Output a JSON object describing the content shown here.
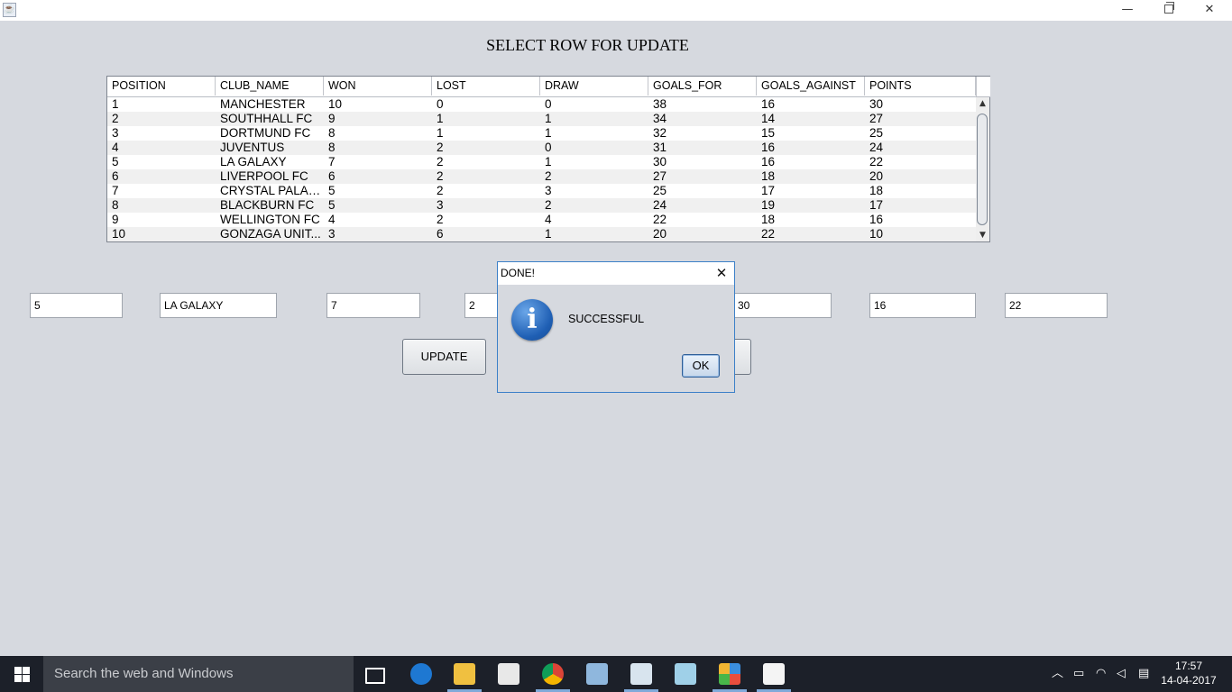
{
  "window": {
    "app_icon_glyph": "☕",
    "minimize_glyph": "—",
    "close_glyph": "✕"
  },
  "heading": "SELECT ROW FOR UPDATE",
  "table": {
    "columns": [
      "POSITION",
      "CLUB_NAME",
      "WON",
      "LOST",
      "DRAW",
      "GOALS_FOR",
      "GOALS_AGAINST",
      "POINTS"
    ],
    "rows": [
      [
        "1",
        "MANCHESTER",
        "10",
        "0",
        "0",
        "38",
        "16",
        "30"
      ],
      [
        "2",
        "SOUTHHALL FC",
        "9",
        "1",
        "1",
        "34",
        "14",
        "27"
      ],
      [
        "3",
        "DORTMUND FC",
        "8",
        "1",
        "1",
        "32",
        "15",
        "25"
      ],
      [
        "4",
        "JUVENTUS",
        "8",
        "2",
        "0",
        "31",
        "16",
        "24"
      ],
      [
        "5",
        "LA GALAXY",
        "7",
        "2",
        "1",
        "30",
        "16",
        "22"
      ],
      [
        "6",
        "LIVERPOOL FC",
        "6",
        "2",
        "2",
        "27",
        "18",
        "20"
      ],
      [
        "7",
        "CRYSTAL PALACE",
        "5",
        "2",
        "3",
        "25",
        "17",
        "18"
      ],
      [
        "8",
        "BLACKBURN FC",
        "5",
        "3",
        "2",
        "24",
        "19",
        "17"
      ],
      [
        "9",
        "WELLINGTON FC",
        "4",
        "2",
        "4",
        "22",
        "18",
        "16"
      ],
      [
        "10",
        "GONZAGA UNIT...",
        "3",
        "6",
        "1",
        "20",
        "22",
        "10"
      ]
    ],
    "scroll_up_glyph": "▲",
    "scroll_down_glyph": "▼"
  },
  "fields": {
    "position": "5",
    "club_name": "LA GALAXY",
    "won": "7",
    "lost": "2",
    "goals_for": "30",
    "goals_against": "16",
    "points": "22"
  },
  "buttons": {
    "update": "UPDATE"
  },
  "dialog": {
    "title": "DONE!",
    "close_glyph": "✕",
    "icon_glyph": "i",
    "message": "SUCCESSFUL",
    "ok": "OK"
  },
  "taskbar": {
    "search_placeholder": "Search the web and Windows",
    "time": "17:57",
    "date": "14-04-2017"
  }
}
